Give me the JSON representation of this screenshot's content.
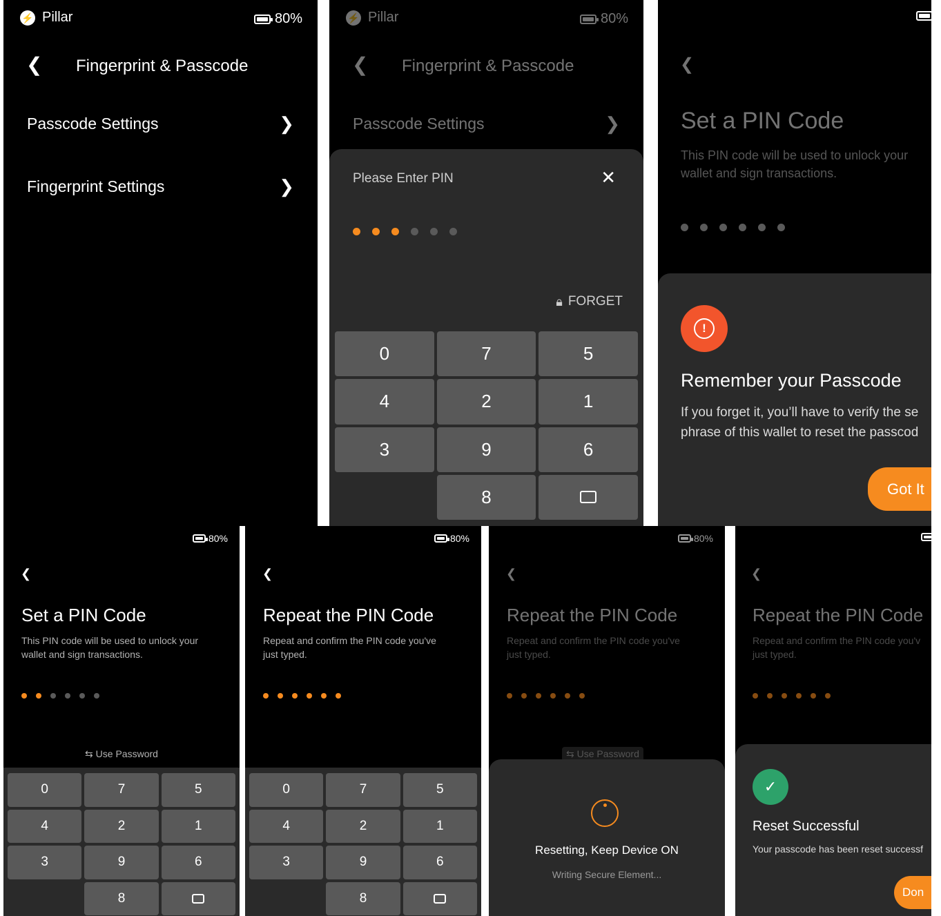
{
  "colors": {
    "accent": "#f68b1f",
    "sheet": "#2a2a2a",
    "key": "#595959",
    "warning": "#f2552c",
    "success": "#2da26a"
  },
  "status": {
    "brand": "Pillar",
    "battery": "80%",
    "battery_level": 0.8
  },
  "screen1": {
    "title": "Fingerprint & Passcode",
    "items": [
      {
        "label": "Passcode Settings"
      },
      {
        "label": "Fingerprint Settings"
      }
    ]
  },
  "screen2": {
    "title": "Fingerprint & Passcode",
    "item": "Passcode Settings",
    "sheet_title": "Please Enter PIN",
    "filled": 3,
    "total": 6,
    "forget": "FORGET",
    "keys": [
      "0",
      "7",
      "5",
      "4",
      "2",
      "1",
      "3",
      "9",
      "6",
      "",
      "8",
      "backspace"
    ]
  },
  "screen3": {
    "title": "Set a PIN Code",
    "subtitle_line1": "This PIN code will be used to unlock your",
    "subtitle_line2": "wallet and sign transactions.",
    "filled": 0,
    "total": 6,
    "modal_title": "Remember your Passcode",
    "modal_line1": "If you forget it, you’ll have to verify the se",
    "modal_line2": "phrase of this wallet to reset the passcod",
    "button": "Got It"
  },
  "screen4": {
    "title": "Set a PIN Code",
    "subtitle_line1": "This PIN code will be used to unlock your",
    "subtitle_line2": "wallet and sign transactions.",
    "filled": 2,
    "total": 6,
    "use_password": "Use Password",
    "keys": [
      "0",
      "7",
      "5",
      "4",
      "2",
      "1",
      "3",
      "9",
      "6",
      "",
      "8",
      "backspace"
    ]
  },
  "screen5": {
    "title": "Repeat the PIN Code",
    "subtitle_line1": "Repeat and confirm the PIN code you've",
    "subtitle_line2": "just typed.",
    "filled": 6,
    "total": 6,
    "keys": [
      "0",
      "7",
      "5",
      "4",
      "2",
      "1",
      "3",
      "9",
      "6",
      "",
      "8",
      "backspace"
    ]
  },
  "screen6": {
    "title": "Repeat the PIN Code",
    "subtitle_line1": "Repeat and confirm the PIN code you've",
    "subtitle_line2": "just typed.",
    "filled": 6,
    "total": 6,
    "use_password": "Use Password",
    "modal_title": "Resetting, Keep Device ON",
    "modal_sub": "Writing Secure Element..."
  },
  "screen7": {
    "title": "Repeat the PIN Code",
    "subtitle_line1": "Repeat and confirm the PIN code you'v",
    "subtitle_line2": "just typed.",
    "filled": 6,
    "total": 6,
    "modal_title": "Reset Successful",
    "modal_sub": "Your passcode has been reset successf",
    "button": "Don"
  }
}
